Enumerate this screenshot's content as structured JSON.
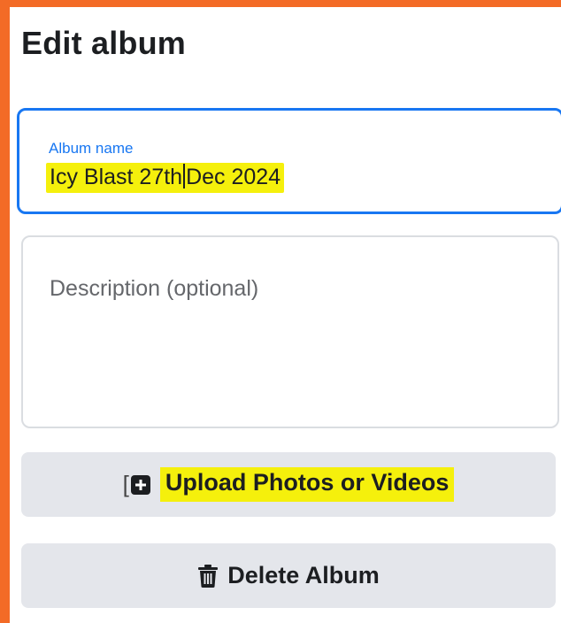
{
  "dialog": {
    "title": "Edit album"
  },
  "album_name_field": {
    "label": "Album name",
    "value_before_cursor": "Icy Blast 27th",
    "value_after_cursor": "Dec 2024"
  },
  "description_field": {
    "placeholder": "Description (optional)",
    "value": ""
  },
  "buttons": {
    "upload_label": "Upload Photos or Videos",
    "delete_label": "Delete Album"
  },
  "icons": {
    "upload": "add-photo-icon",
    "delete": "trash-icon"
  },
  "colors": {
    "accent": "#1877F2",
    "highlight": "#F5F00C",
    "frame": "#F36B26",
    "button_bg": "#E4E6EB"
  }
}
